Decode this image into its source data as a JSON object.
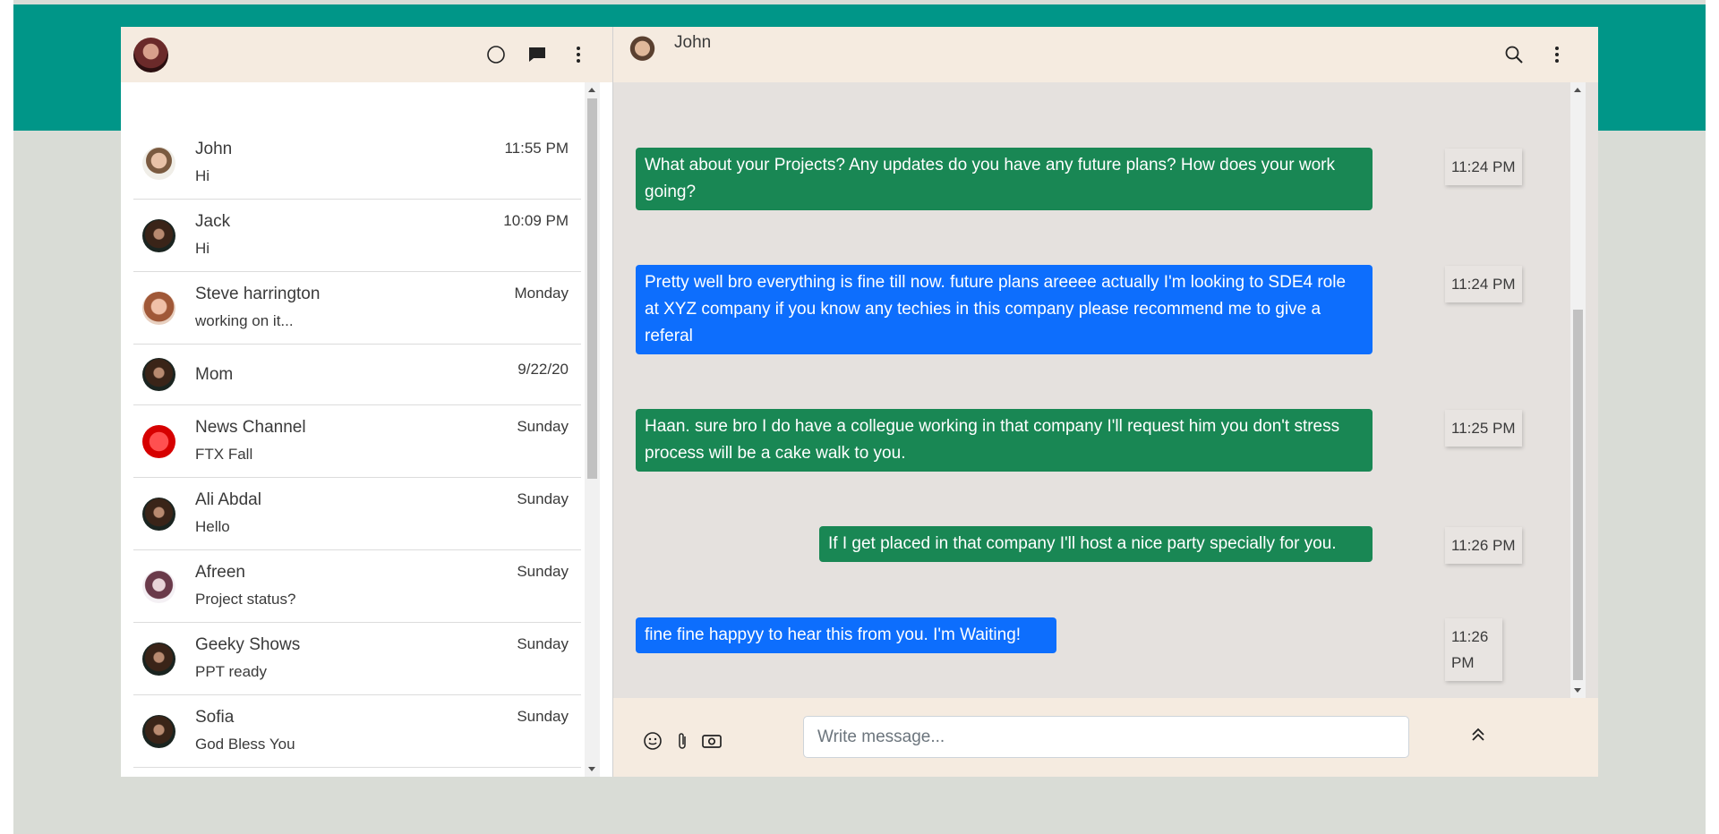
{
  "colors": {
    "teal": "#009688",
    "panel_header": "#f5ebe0",
    "chat_bg": "#e5e1de",
    "green_bubble": "#198754",
    "blue_bubble": "#0d6efd"
  },
  "sidebar": {
    "icons": [
      "status-icon",
      "new-chat-icon",
      "menu-icon"
    ],
    "chats": [
      {
        "name": "John",
        "last": "Hi",
        "time": "11:55 PM"
      },
      {
        "name": "Jack",
        "last": "Hi",
        "time": "10:09 PM"
      },
      {
        "name": "Steve harrington",
        "last": "working on it...",
        "time": "Monday"
      },
      {
        "name": "Mom",
        "last": "",
        "time": "9/22/20"
      },
      {
        "name": "News Channel",
        "last": "FTX Fall",
        "time": "Sunday"
      },
      {
        "name": "Ali Abdal",
        "last": "Hello",
        "time": "Sunday"
      },
      {
        "name": "Afreen",
        "last": "Project status?",
        "time": "Sunday"
      },
      {
        "name": "Geeky Shows",
        "last": "PPT ready",
        "time": "Sunday"
      },
      {
        "name": "Sofia",
        "last": "God Bless You",
        "time": "Sunday"
      }
    ]
  },
  "conversation": {
    "contact": "John",
    "messages": [
      {
        "text": "What about your Projects? Any updates do you have any future plans? How does your work going?",
        "color": "green",
        "time": "11:24 PM"
      },
      {
        "text": "Pretty well bro everything is fine till now. future plans areeee actually I'm looking to SDE4 role at XYZ company if you know any techies in this company please recommend me to give a referal",
        "color": "blue",
        "time": "11:24 PM"
      },
      {
        "text": "Haan. sure bro I do have a collegue working in that company I'll request him you don't stress process will be a cake walk to you.",
        "color": "green",
        "time": "11:25 PM"
      },
      {
        "text": "If I get placed in that company I'll host a nice party specially for you.",
        "color": "green",
        "time": "11:26 PM"
      },
      {
        "text": "fine fine happyy to hear this from you. I'm Waiting!",
        "color": "blue",
        "time": "11:26 PM"
      }
    ]
  },
  "composer": {
    "placeholder": "Write message...",
    "value": ""
  }
}
